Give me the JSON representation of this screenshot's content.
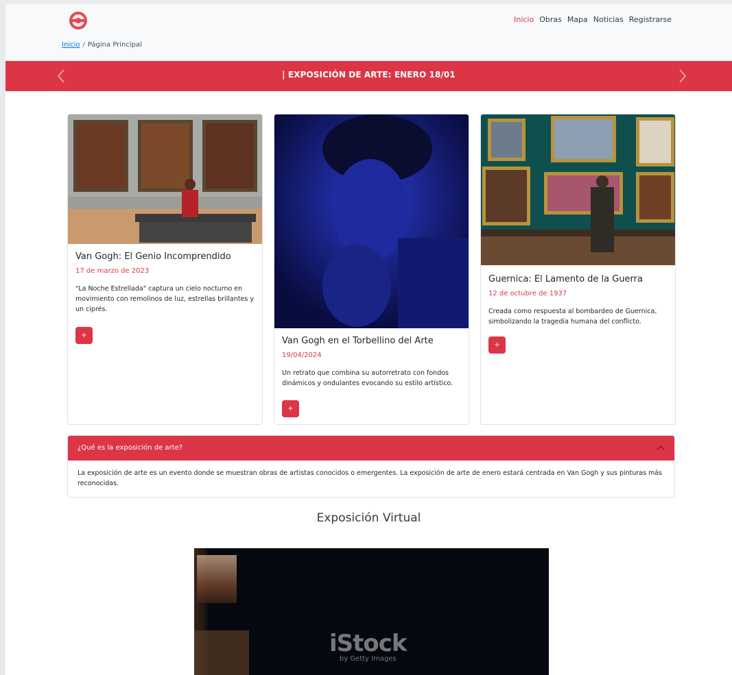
{
  "header": {
    "logo_icon": "museum-logo-icon",
    "nav": [
      "Inicio",
      "Obras",
      "Mapa",
      "Noticias",
      "Registrarse"
    ],
    "active_nav": "Inicio"
  },
  "breadcrumb": {
    "link": "Inicio",
    "separator": "/",
    "current": "Página Principal"
  },
  "banner": {
    "text": "| EXPOSICIÓN DE ARTE: ENERO 18/01",
    "prev_icon": "chevron-left-icon",
    "next_icon": "chevron-right-icon",
    "color": "#dc3545"
  },
  "cards": [
    {
      "title": "Van Gogh: El Genio Incomprendido",
      "date": "17 de marzo de 2023",
      "text": "\"La Noche Estrellada\" captura un cielo nocturno en movimiento con remolinos de luz, estrellas brillantes y un ciprés.",
      "button": "+"
    },
    {
      "title": "Van Gogh en el Torbellino del Arte",
      "date": "19/04/2024",
      "text": "Un retrato que combina su autorretrato con fondos dinámicos y ondulantes evocando su estilo artístico.",
      "button": "+"
    },
    {
      "title": "Guernica: El Lamento de la Guerra",
      "date": "12 de octubre de 1937",
      "text": "Creada como respuesta al bombardeo de Guernica, simbolizando la tragedia humana del conflicto.",
      "button": "+"
    }
  ],
  "accordion": {
    "question": "¿Qué es la exposición de arte?",
    "answer": "La exposición de arte es un evento donde se muestran obras de artistas conocidos o emergentes. La exposición de arte de enero estará centrada en Van Gogh y sus pinturas más reconocidas.",
    "icon": "chevron-up-icon"
  },
  "virtual": {
    "title": "Exposición Virtual",
    "watermark_main": "iStock",
    "watermark_sub": "by Getty Images"
  },
  "colors": {
    "accent": "#dc3545",
    "header_bg": "#f8f9fa"
  }
}
